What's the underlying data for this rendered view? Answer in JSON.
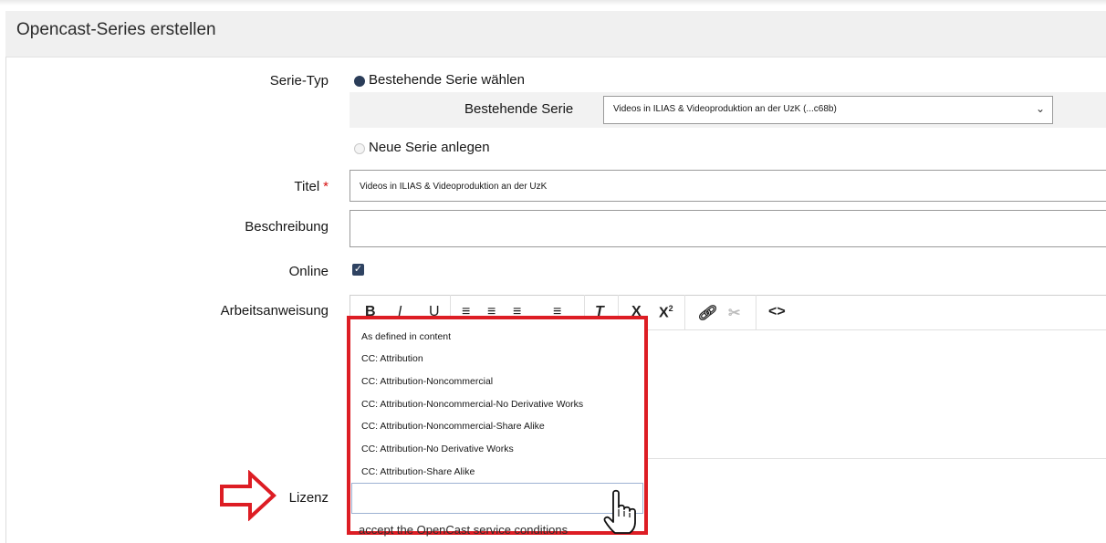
{
  "header": {
    "title": "Opencast-Series erstellen"
  },
  "form": {
    "serie_typ": {
      "label": "Serie-Typ",
      "option_existing": "Bestehende Serie wählen",
      "option_new": "Neue Serie anlegen",
      "existing_label": "Bestehende Serie",
      "existing_value": "Videos in ILIAS & Videoproduktion an der UzK (...c68b)"
    },
    "titel": {
      "label": "Titel",
      "required_mark": "*",
      "value": "Videos in ILIAS & Videoproduktion an der UzK"
    },
    "beschreibung": {
      "label": "Beschreibung",
      "value": ""
    },
    "online": {
      "label": "Online",
      "checked": true
    },
    "arbeitsanweisung": {
      "label": "Arbeitsanweisung",
      "toolbar": [
        "B",
        "I",
        "U",
        "align-left",
        "align-center",
        "align-right",
        "align-justify",
        "clear-format",
        "subscript",
        "superscript",
        "link",
        "unlink",
        "source-code"
      ]
    },
    "lizenz": {
      "label": "Lizenz",
      "options": [
        "As defined in content",
        "CC: Attribution",
        "CC: Attribution-Noncommercial",
        "CC: Attribution-Noncommercial-No Derivative Works",
        "CC: Attribution-Noncommercial-Share Alike",
        "CC: Attribution-No Derivative Works",
        "CC: Attribution-Share Alike"
      ],
      "value": ""
    },
    "cut_text": "accept the OpenCast service conditions"
  },
  "colors": {
    "highlight": "#dd1d24",
    "radio_on": "#2b3d59",
    "required": "#d60f0f"
  }
}
